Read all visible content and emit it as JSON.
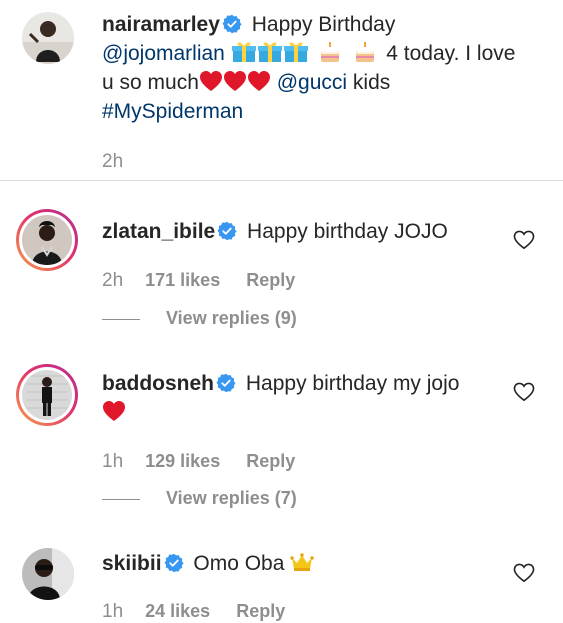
{
  "post_caption": {
    "username": "nairamarley",
    "text_1": "Happy Birthday",
    "mention_1": "@jojomarlian",
    "text_2": "4 today. I love",
    "text_3": "u so much",
    "mention_2": "@gucci",
    "text_4": "kids",
    "hashtag": "#MySpiderman",
    "time": "2h",
    "verified": true
  },
  "comments": [
    {
      "username": "zlatan_ibile",
      "text": "Happy birthday JOJO",
      "time": "2h",
      "likes": "171 likes",
      "reply_label": "Reply",
      "view_replies": "View replies (9)",
      "has_story_ring": true
    },
    {
      "username": "baddosneh",
      "text": "Happy birthday my jojo",
      "time": "1h",
      "likes": "129 likes",
      "reply_label": "Reply",
      "view_replies": "View replies (7)",
      "has_story_ring": true
    },
    {
      "username": "skiibii",
      "text": "Omo Oba",
      "time": "1h",
      "likes": "24 likes",
      "reply_label": "Reply",
      "has_story_ring": false
    }
  ],
  "colors": {
    "verified_blue": "#3897f0",
    "link_blue": "#00376b",
    "meta_gray": "#8e8e8e",
    "heart_red": "#e0162b"
  },
  "icons": [
    "verified-badge-icon",
    "gift-emoji-icon",
    "birthday-cake-emoji-icon",
    "red-heart-emoji-icon",
    "crown-emoji-icon",
    "like-heart-icon"
  ]
}
